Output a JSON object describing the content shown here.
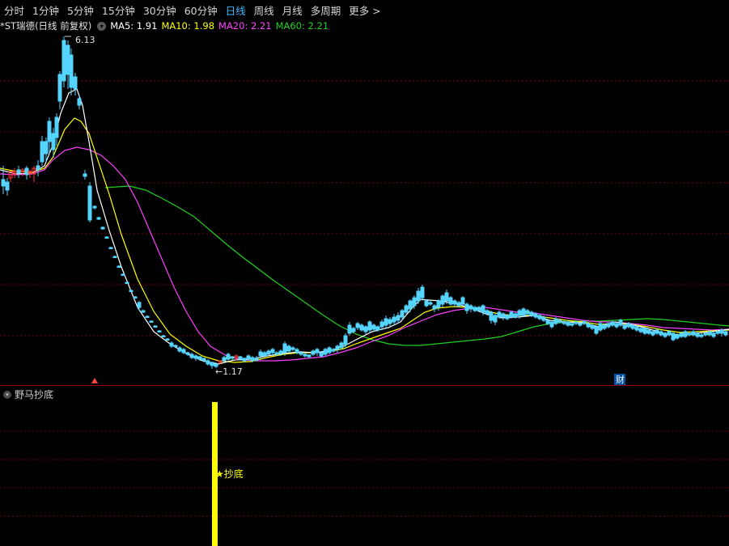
{
  "toolbar": {
    "tabs": [
      "分时",
      "1分钟",
      "5分钟",
      "15分钟",
      "30分钟",
      "60分钟",
      "日线",
      "周线",
      "月线",
      "多周期",
      "更多 >"
    ],
    "active_tab": "日线"
  },
  "info": {
    "title": "*ST瑞德(日线 前复权)",
    "ma5": "MA5: 1.91",
    "ma10": "MA10: 1.98",
    "ma20": "MA20: 2.21",
    "ma60": "MA60: 2.21",
    "colors": {
      "ma5": "#ffffff",
      "ma10": "#ffff00",
      "ma20": "#ff40ff",
      "ma60": "#20d020"
    }
  },
  "price_chart": {
    "high_label": "6.13",
    "low_label": "1.17",
    "fin_marker": "财",
    "colors": {
      "up": "#ff3232",
      "down": "#54d4ff",
      "grid": "#7a0000"
    }
  },
  "indicator": {
    "name": "野马抄底",
    "signal_label": "★抄底",
    "bar_color": "#ffff00"
  }
}
